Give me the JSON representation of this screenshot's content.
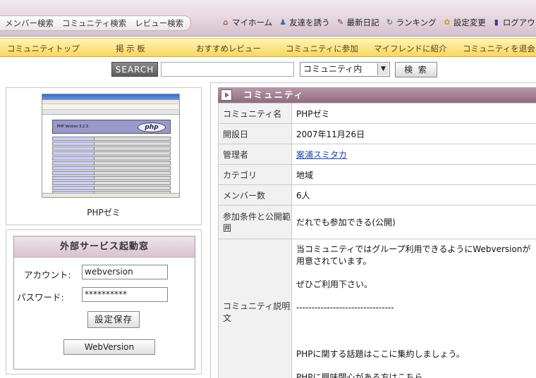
{
  "topbar": {
    "search_tabs": [
      "メンバー検索",
      "コミュニティ検索",
      "レビュー検索"
    ],
    "menu": [
      {
        "label": "マイホーム",
        "icon": "home-icon"
      },
      {
        "label": "友達を誘う",
        "icon": "invite-friends-icon"
      },
      {
        "label": "最新日記",
        "icon": "diary-pencil-icon"
      },
      {
        "label": "ランキング",
        "icon": "ranking-icon"
      },
      {
        "label": "設定変更",
        "icon": "settings-gear-icon"
      },
      {
        "label": "ログアウ",
        "icon": "logout-door-icon"
      }
    ]
  },
  "community_menu": [
    "コミュニティトップ",
    "掲 示 板",
    "おすすめレビュー",
    "コミュニティに参加",
    "マイフレンドに紹介",
    "コミュニティを退会"
  ],
  "search": {
    "button_label": "SEARCH",
    "input_value": "",
    "scope_selected": "コミュニティ内",
    "submit_label": "検 索"
  },
  "left": {
    "community_name": "PHPゼミ",
    "thumbnail_title": "PHP Version 5.2.3",
    "thumbnail_logo": "php"
  },
  "external_service": {
    "title": "外部サービス起動窓",
    "account_label": "アカウント:",
    "account_value": "webversion",
    "password_label": "パスワード:",
    "password_value": "**********",
    "save_button": "設定保存",
    "launch_button": "WebVersion"
  },
  "community_info": {
    "header": "コミュニティ",
    "rows": [
      {
        "label": "コミュニティ名",
        "value": "PHPゼミ"
      },
      {
        "label": "開設日",
        "value": "2007年11月26日"
      },
      {
        "label": "管理者",
        "value": "案浦スミタカ"
      },
      {
        "label": "カテゴリ",
        "value": "地域"
      },
      {
        "label": "メンバー数",
        "value": "6人"
      },
      {
        "label": "参加条件と公開範囲",
        "value": "だれでも参加できる(公開)"
      }
    ],
    "description_label": "コミュニティ説明文",
    "description_lines": [
      "当コミュニティではグループ利用できるようにWebversionが用意されています。",
      "ぜひご利用下さい。",
      "--------------------------------",
      "",
      "PHPに関する話題はここに集約しましょう。",
      "PHPに興味関心がある方はこちら。"
    ]
  },
  "colors": {
    "topbar": "#e7d9e2",
    "community_menu": "#f5d860",
    "header_band": "#8f6a7d",
    "link": "#1a3fa8"
  }
}
